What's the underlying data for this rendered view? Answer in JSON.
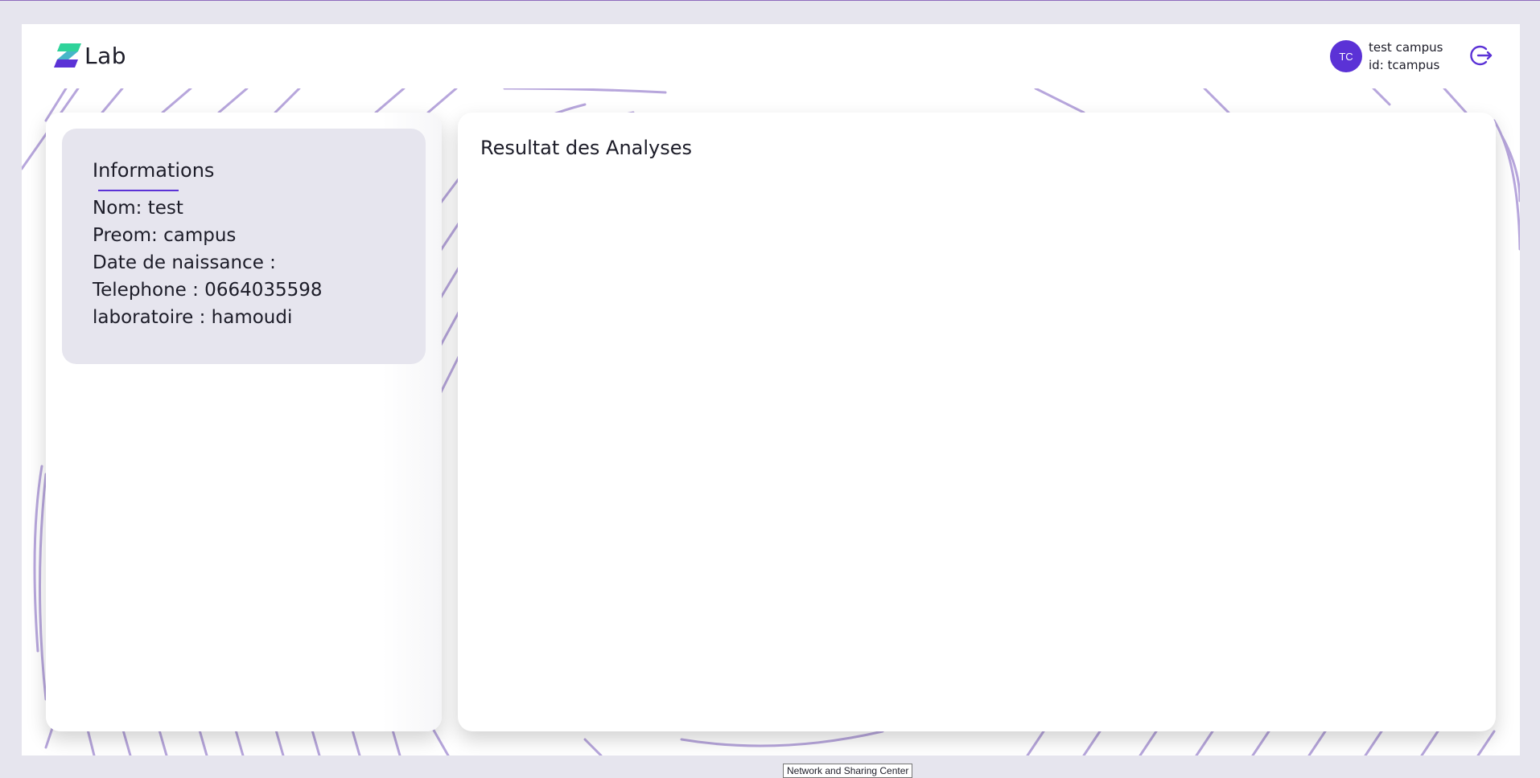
{
  "header": {
    "logo_text": "Lab",
    "user": {
      "initials": "TC",
      "name": "test campus",
      "id_line": "id: tcampus"
    },
    "logout_icon": "logout-icon"
  },
  "info": {
    "title": "Informations",
    "lines": [
      "Nom: test",
      "Preom: campus",
      "Date de naissance :",
      "Telephone : 0664035598",
      "laboratoire : hamoudi"
    ]
  },
  "results": {
    "title": "Resultat des Analyses"
  },
  "tooltip": {
    "text": "Network and Sharing Center"
  },
  "colors": {
    "accent": "#5b32d6",
    "logo_green": "#2fd39a",
    "background": "#e6e5ee",
    "pattern": "#b7a6dc"
  }
}
